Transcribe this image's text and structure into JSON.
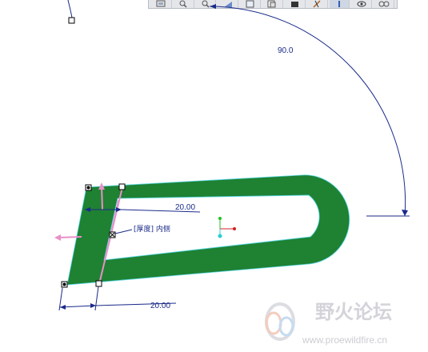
{
  "toolbar": {
    "buttons": [
      {
        "name": "zoom-fit-icon",
        "active": false
      },
      {
        "name": "zoom-in-icon",
        "active": false
      },
      {
        "name": "zoom-out-icon",
        "active": false
      },
      {
        "name": "repaint-icon",
        "active": false
      },
      {
        "name": "view-orient-icon",
        "active": false
      },
      {
        "name": "saved-views-icon",
        "active": false
      },
      {
        "name": "display-style-icon",
        "active": false
      },
      {
        "name": "datum-display-icon",
        "active": false
      },
      {
        "name": "annotation-display-icon",
        "active": true
      },
      {
        "name": "visibility-icon",
        "active": false
      },
      {
        "name": "spin-center-icon",
        "active": false
      }
    ]
  },
  "sketch": {
    "angle_dimension": "90.0",
    "dimension_top": "20.00",
    "dimension_bottom": "20.00",
    "thickness_label": "[厚度] 内侧"
  },
  "colors": {
    "solid_fill": "#1f8132",
    "dimension": "#1a2a8a",
    "drag_arrow": "#e890c8",
    "edge": "#55d7e6"
  },
  "watermark": {
    "cn": "野火论坛",
    "url": "www.proewildfire.cn"
  }
}
